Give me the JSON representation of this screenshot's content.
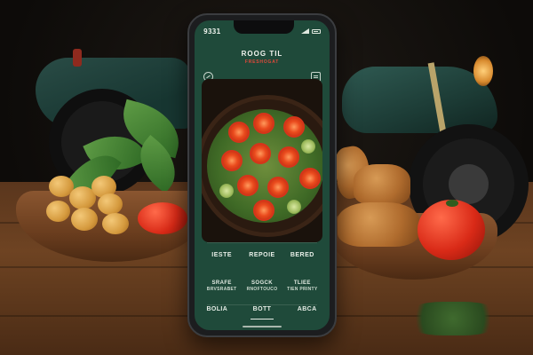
{
  "status_bar": {
    "time": "9331"
  },
  "app": {
    "title": "ROOG TIL",
    "subtitle": "FRESHOGAT"
  },
  "menu": {
    "headers": [
      "IESTE",
      "REPOIE",
      "BERED"
    ],
    "items": [
      {
        "line1": "SRAFE",
        "line2": "BRVSRABET"
      },
      {
        "line1": "SOGCK",
        "line2": "RNOFTOUCO"
      },
      {
        "line1": "TLIEE",
        "line2": "TIEN PRINTY"
      }
    ]
  },
  "tabs": [
    {
      "label": "BOLIA",
      "active": false
    },
    {
      "label": "BOTT",
      "active": true
    },
    {
      "label": "ABCA",
      "active": false
    }
  ],
  "icons": {
    "header_left": "search-icon",
    "header_right": "menu-icon",
    "status_signal": "signal-icon",
    "status_battery": "battery-icon"
  },
  "colors": {
    "screen_bg": "#1f4a3a",
    "accent_red": "#e0493a",
    "text_light": "#f1f4ef"
  }
}
